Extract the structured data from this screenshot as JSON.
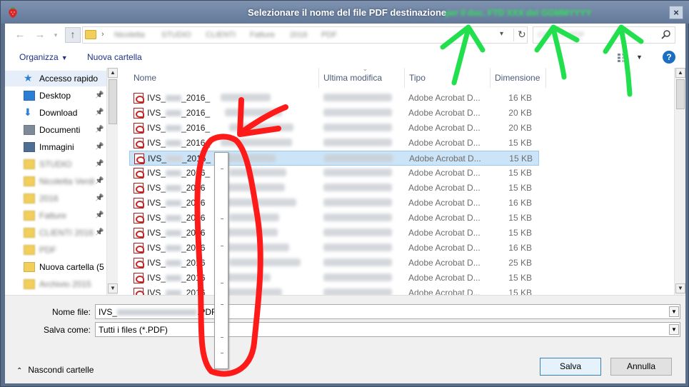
{
  "window": {
    "title": "Selezionare il nome del file PDF destinazione",
    "title_extra": "per il doc. FTD XXX del GGMMYYYY",
    "close_label": "×"
  },
  "address": {
    "crumbs": [
      "Nicoletta",
      "STUDIO",
      "CLIENTI",
      "Fatture",
      "2016",
      "PDF"
    ],
    "search_placeholder": "Cerca in PDF"
  },
  "toolbar": {
    "organize_label": "Organizza",
    "new_folder_label": "Nuova cartella",
    "help_label": "?"
  },
  "nav_pane": {
    "items": [
      {
        "label": "Accesso rapido",
        "icon": "star-icon",
        "selected": true,
        "pinned": false,
        "blurred": false
      },
      {
        "label": "Desktop",
        "icon": "desktop-icon",
        "selected": false,
        "pinned": true,
        "blurred": false
      },
      {
        "label": "Download",
        "icon": "download-icon",
        "selected": false,
        "pinned": true,
        "blurred": false
      },
      {
        "label": "Documenti",
        "icon": "documents-icon",
        "selected": false,
        "pinned": true,
        "blurred": false
      },
      {
        "label": "Immagini",
        "icon": "pictures-icon",
        "selected": false,
        "pinned": true,
        "blurred": false
      },
      {
        "label": "STUDIO",
        "icon": "folder-icon",
        "selected": false,
        "pinned": true,
        "blurred": true
      },
      {
        "label": "Nicoletta Verdi",
        "icon": "folder-icon",
        "selected": false,
        "pinned": true,
        "blurred": true
      },
      {
        "label": "2016",
        "icon": "folder-icon",
        "selected": false,
        "pinned": true,
        "blurred": true
      },
      {
        "label": "Fatture",
        "icon": "folder-icon",
        "selected": false,
        "pinned": true,
        "blurred": true
      },
      {
        "label": "CLIENTI 2016",
        "icon": "folder-icon",
        "selected": false,
        "pinned": true,
        "blurred": true
      },
      {
        "label": "PDF",
        "icon": "folder-icon",
        "selected": false,
        "pinned": false,
        "blurred": true
      },
      {
        "label": "Nuova cartella (5",
        "icon": "folder-icon",
        "selected": false,
        "pinned": false,
        "blurred": false
      },
      {
        "label": "Archivio 2015",
        "icon": "folder-icon",
        "selected": false,
        "pinned": false,
        "blurred": true
      }
    ]
  },
  "file_list": {
    "columns": [
      "Nome",
      "Ultima modifica",
      "Tipo",
      "Dimensione"
    ],
    "rows": [
      {
        "name": "IVS_",
        "name_mid": "_2016_",
        "type": "Adobe Acrobat D...",
        "size": "16 KB",
        "selected": false
      },
      {
        "name": "IVS_",
        "name_mid": "_2016_",
        "type": "Adobe Acrobat D...",
        "size": "20 KB",
        "selected": false
      },
      {
        "name": "IVS_",
        "name_mid": "_2016_",
        "type": "Adobe Acrobat D...",
        "size": "20 KB",
        "selected": false
      },
      {
        "name": "IVS_",
        "name_mid": "_2016_",
        "type": "Adobe Acrobat D...",
        "size": "15 KB",
        "selected": false
      },
      {
        "name": "IVS_",
        "name_mid": "_2016_",
        "type": "Adobe Acrobat D...",
        "size": "15 KB",
        "selected": true
      },
      {
        "name": "IVS_",
        "name_mid": "_2016_",
        "type": "Adobe Acrobat D...",
        "size": "15 KB",
        "selected": false
      },
      {
        "name": "IVS_",
        "name_mid": "_2016",
        "type": "Adobe Acrobat D...",
        "size": "15 KB",
        "selected": false
      },
      {
        "name": "IVS_",
        "name_mid": "_2016",
        "type": "Adobe Acrobat D...",
        "size": "16 KB",
        "selected": false
      },
      {
        "name": "IVS_",
        "name_mid": "_2016",
        "type": "Adobe Acrobat D...",
        "size": "15 KB",
        "selected": false
      },
      {
        "name": "IVS_",
        "name_mid": "_2016",
        "type": "Adobe Acrobat D...",
        "size": "15 KB",
        "selected": false
      },
      {
        "name": "IVS_",
        "name_mid": "_2016",
        "type": "Adobe Acrobat D...",
        "size": "16 KB",
        "selected": false
      },
      {
        "name": "IVS_",
        "name_mid": "_2016",
        "type": "Adobe Acrobat D...",
        "size": "25 KB",
        "selected": false
      },
      {
        "name": "IVS_",
        "name_mid": "_2016",
        "type": "Adobe Acrobat D...",
        "size": "15 KB",
        "selected": false
      },
      {
        "name": "IVS_",
        "name_mid": "_2016",
        "type": "Adobe Acrobat D...",
        "size": "15 KB",
        "selected": false
      }
    ]
  },
  "fields": {
    "filename_label": "Nome file:",
    "filename_prefix": "IVS_",
    "filename_suffix": ".PDF",
    "save_as_label": "Salva come:",
    "save_as_value": "Tutti i files (*.PDF)"
  },
  "footer": {
    "hide_folders_label": "Nascondi cartelle",
    "save_button": "Salva",
    "cancel_button": "Annulla"
  },
  "colors": {
    "titlebar": "#6b80a0",
    "annotation_red": "#ff0000",
    "annotation_green": "#22e04d",
    "selection": "#cce4f7"
  }
}
